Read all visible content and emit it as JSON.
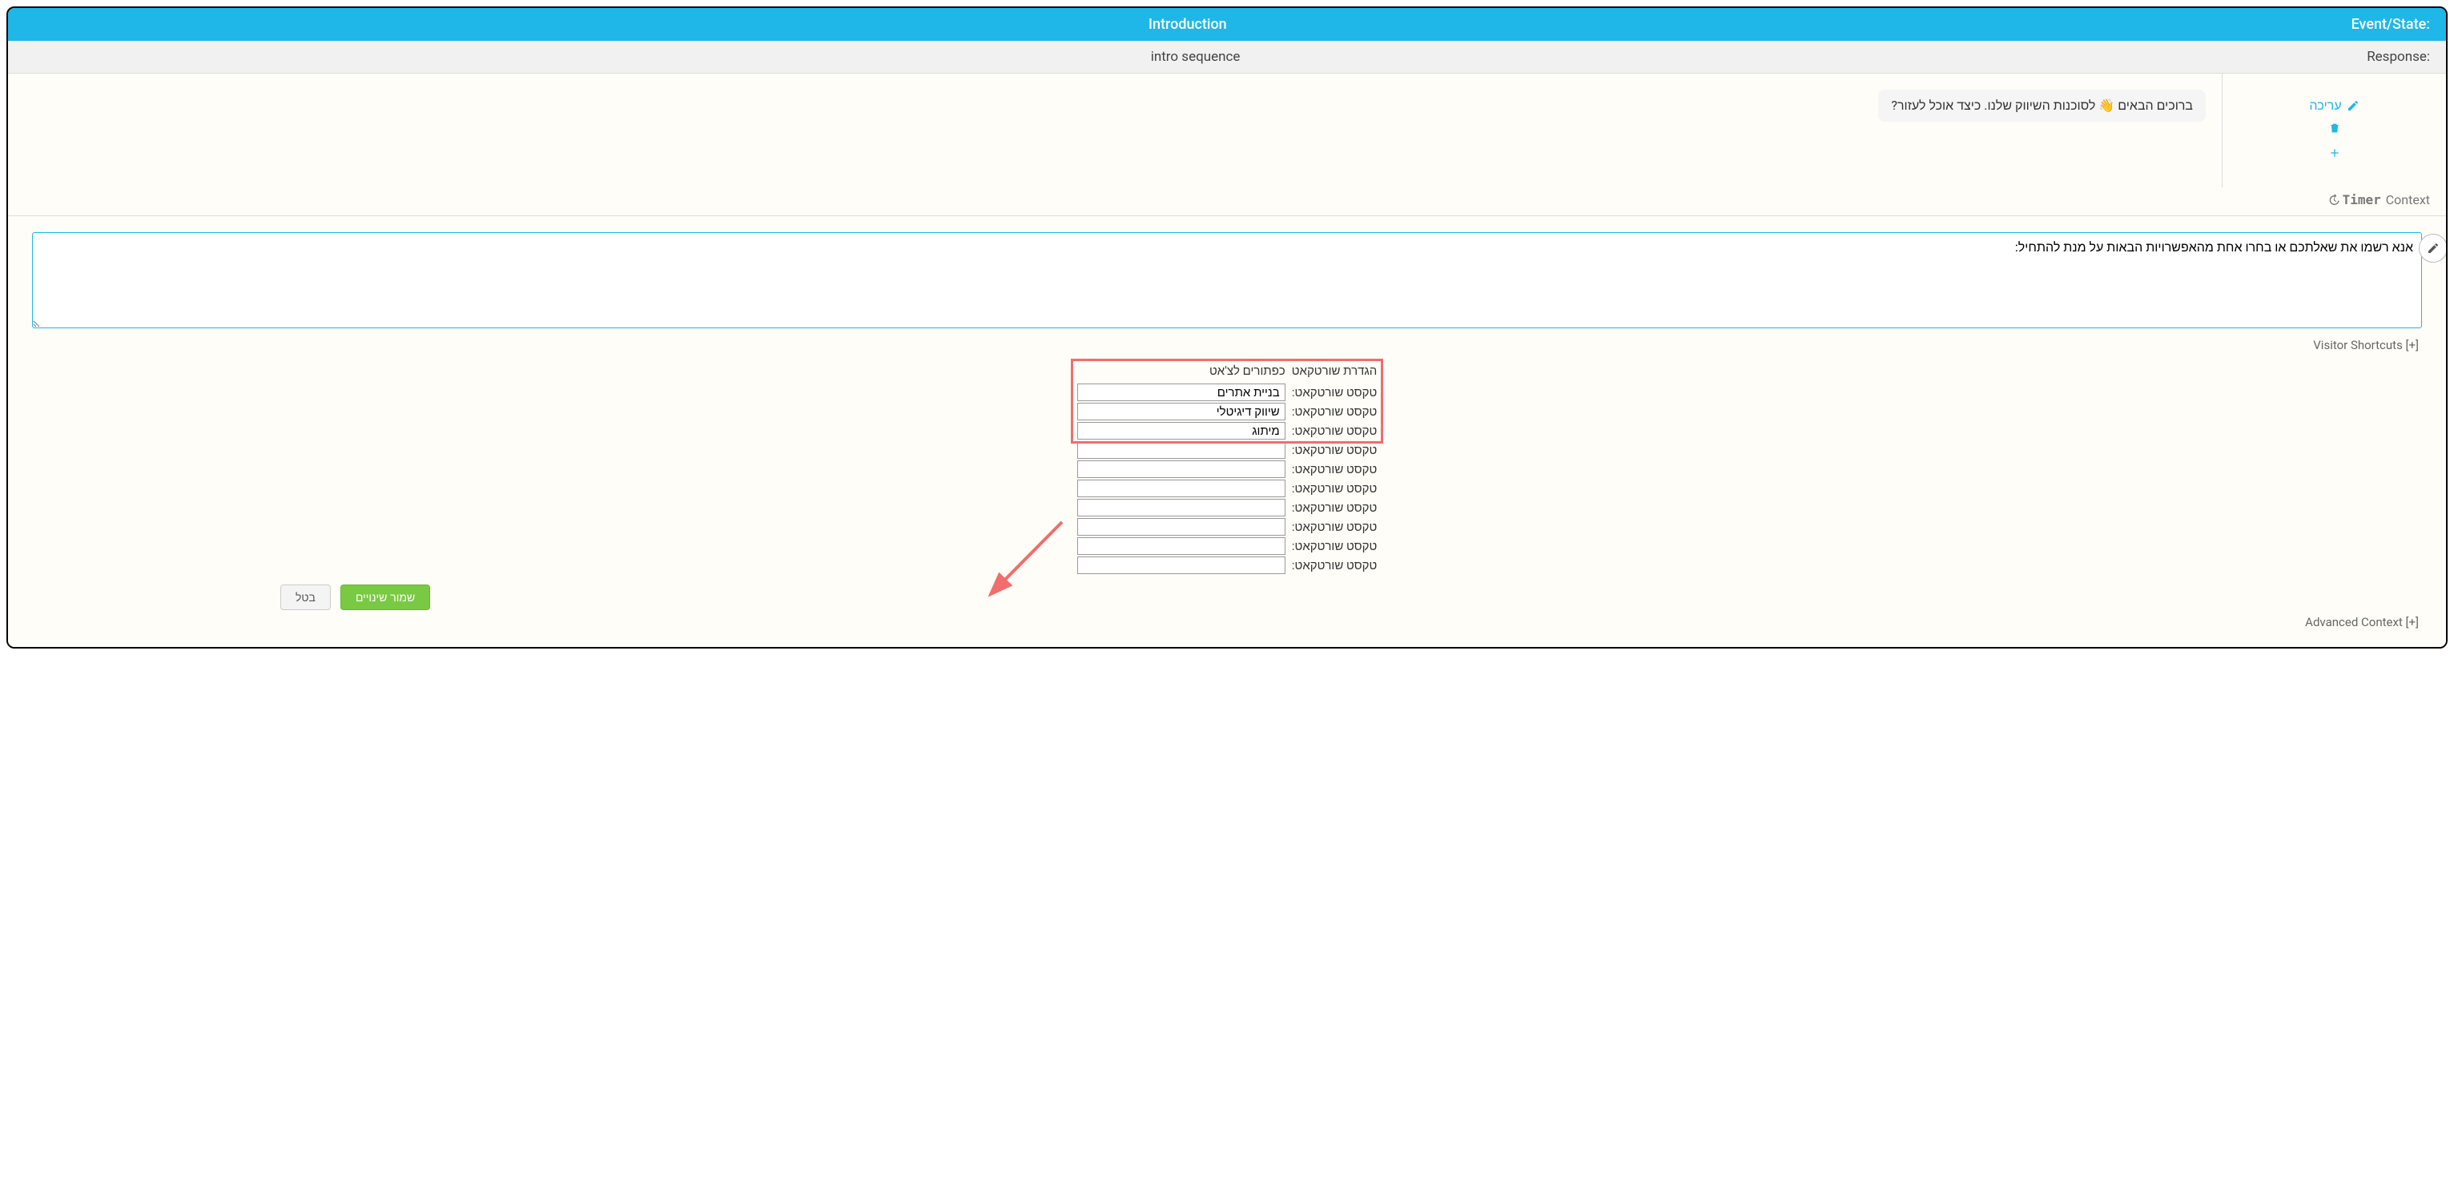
{
  "header": {
    "event_state_label": "Event/State:",
    "event_state_value": "Introduction",
    "response_label": "Response:",
    "response_value": "intro sequence"
  },
  "sidebar": {
    "edit_label": "עריכה"
  },
  "bubble": {
    "text": "ברוכים הבאים 👋 לסוכנות השיווק שלנו. כיצד אוכל לעזור?"
  },
  "context_row": {
    "label": "Context",
    "timer": "Timer"
  },
  "editor": {
    "textarea_value": "אנא רשמו את שאלתכם או בחרו אחת מהאפשרויות הבאות על מנת להתחיל:",
    "visitor_shortcuts_label": "Visitor Shortcuts [+]",
    "advanced_context_label": "Advanced Context [+]"
  },
  "shortcuts": {
    "col_define": "הגדרת שורטקאט",
    "col_buttons": "כפתורים לצ'אט",
    "row_label": "טקסט שורטקאט:",
    "values": [
      "בניית אתרים",
      "שיווק דיגיטלי",
      "מיתוג",
      "",
      "",
      "",
      "",
      "",
      "",
      ""
    ]
  },
  "buttons": {
    "cancel": "בטל",
    "save": "שמור שינויים"
  }
}
